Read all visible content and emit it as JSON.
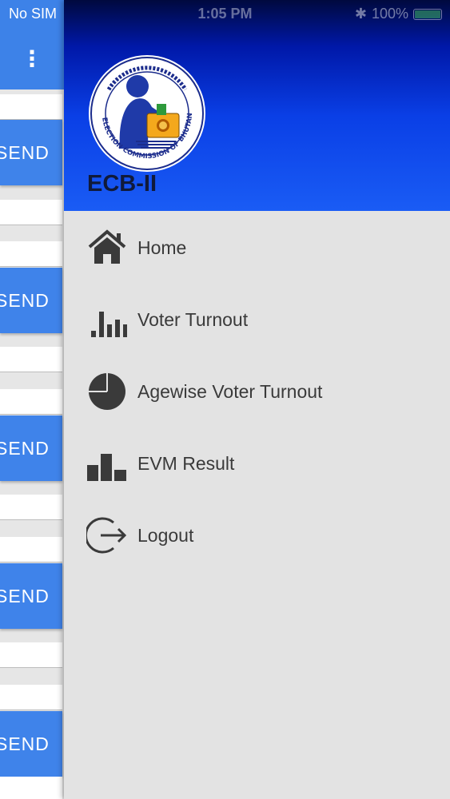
{
  "status_bar": {
    "carrier": "No SIM",
    "time": "1:05 PM",
    "battery": "100%"
  },
  "background_app": {
    "send_label": "SEND"
  },
  "drawer": {
    "title": "ECB-II",
    "logo_text": "ELECTION COMMISSION OF BHUTAN",
    "logo_tagline": "Ensuring Free, Fair and Democratic Elections and Referendums",
    "menu": [
      {
        "label": "Home",
        "icon": "home-icon"
      },
      {
        "label": "Voter Turnout",
        "icon": "bar-chart-icon"
      },
      {
        "label": "Agewise Voter Turnout",
        "icon": "pie-chart-icon"
      },
      {
        "label": "EVM Result",
        "icon": "blocks-chart-icon"
      },
      {
        "label": "Logout",
        "icon": "logout-icon"
      }
    ]
  },
  "colors": {
    "accent_blue": "#3f83ea",
    "header_dark": "#00093e",
    "header_light": "#1a5cf5",
    "drawer_bg": "#e3e3e3"
  }
}
